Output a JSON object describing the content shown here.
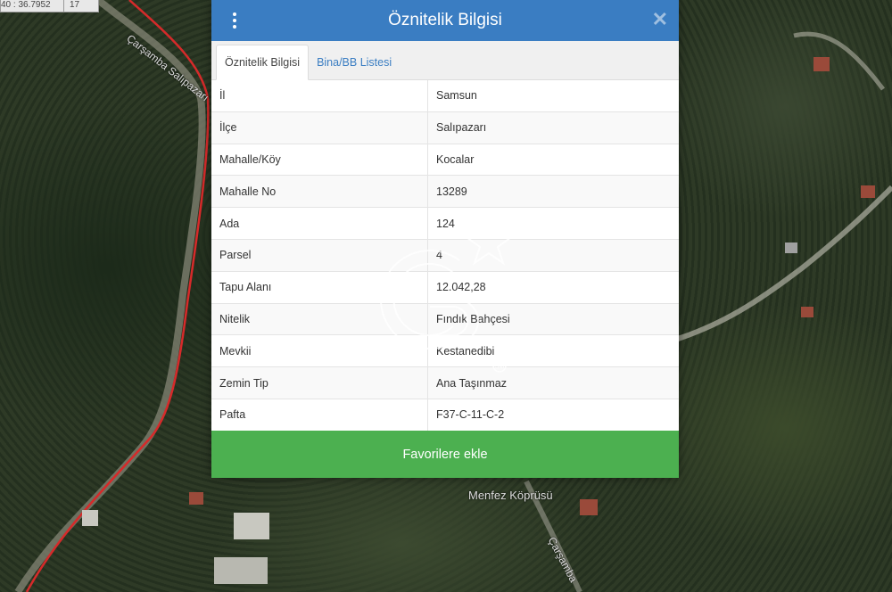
{
  "map": {
    "coord_readout": "40 : 36.7952",
    "zoom_level": "17",
    "road_label_1": "Çarşamba Salıpazarı",
    "road_label_2": "Çarşamba",
    "bridge_label": "Menfez Köprüsü"
  },
  "modal": {
    "title": "Öznitelik Bilgisi",
    "close_symbol": "✕",
    "tabs": [
      {
        "label": "Öznitelik Bilgisi",
        "active": true
      },
      {
        "label": "Bina/BB Listesi",
        "active": false
      }
    ],
    "rows": [
      {
        "key": "İl",
        "value": "Samsun"
      },
      {
        "key": "İlçe",
        "value": "Salıpazarı"
      },
      {
        "key": "Mahalle/Köy",
        "value": "Kocalar"
      },
      {
        "key": "Mahalle No",
        "value": "13289"
      },
      {
        "key": "Ada",
        "value": "124"
      },
      {
        "key": "Parsel",
        "value": "4"
      },
      {
        "key": "Tapu Alanı",
        "value": "12.042,28"
      },
      {
        "key": "Nitelik",
        "value": "Fındık Bahçesi"
      },
      {
        "key": "Mevkii",
        "value": "Kestanedibi"
      },
      {
        "key": "Zemin Tip",
        "value": "Ana Taşınmaz"
      },
      {
        "key": "Pafta",
        "value": "F37-C-11-C-2"
      }
    ],
    "favorite_button": "Favorilere ekle"
  },
  "watermark": {
    "mark": "SM"
  },
  "colors": {
    "header": "#3a7dc2",
    "favorite_button": "#4cb050",
    "parcel_outline": "#d62a2a"
  }
}
